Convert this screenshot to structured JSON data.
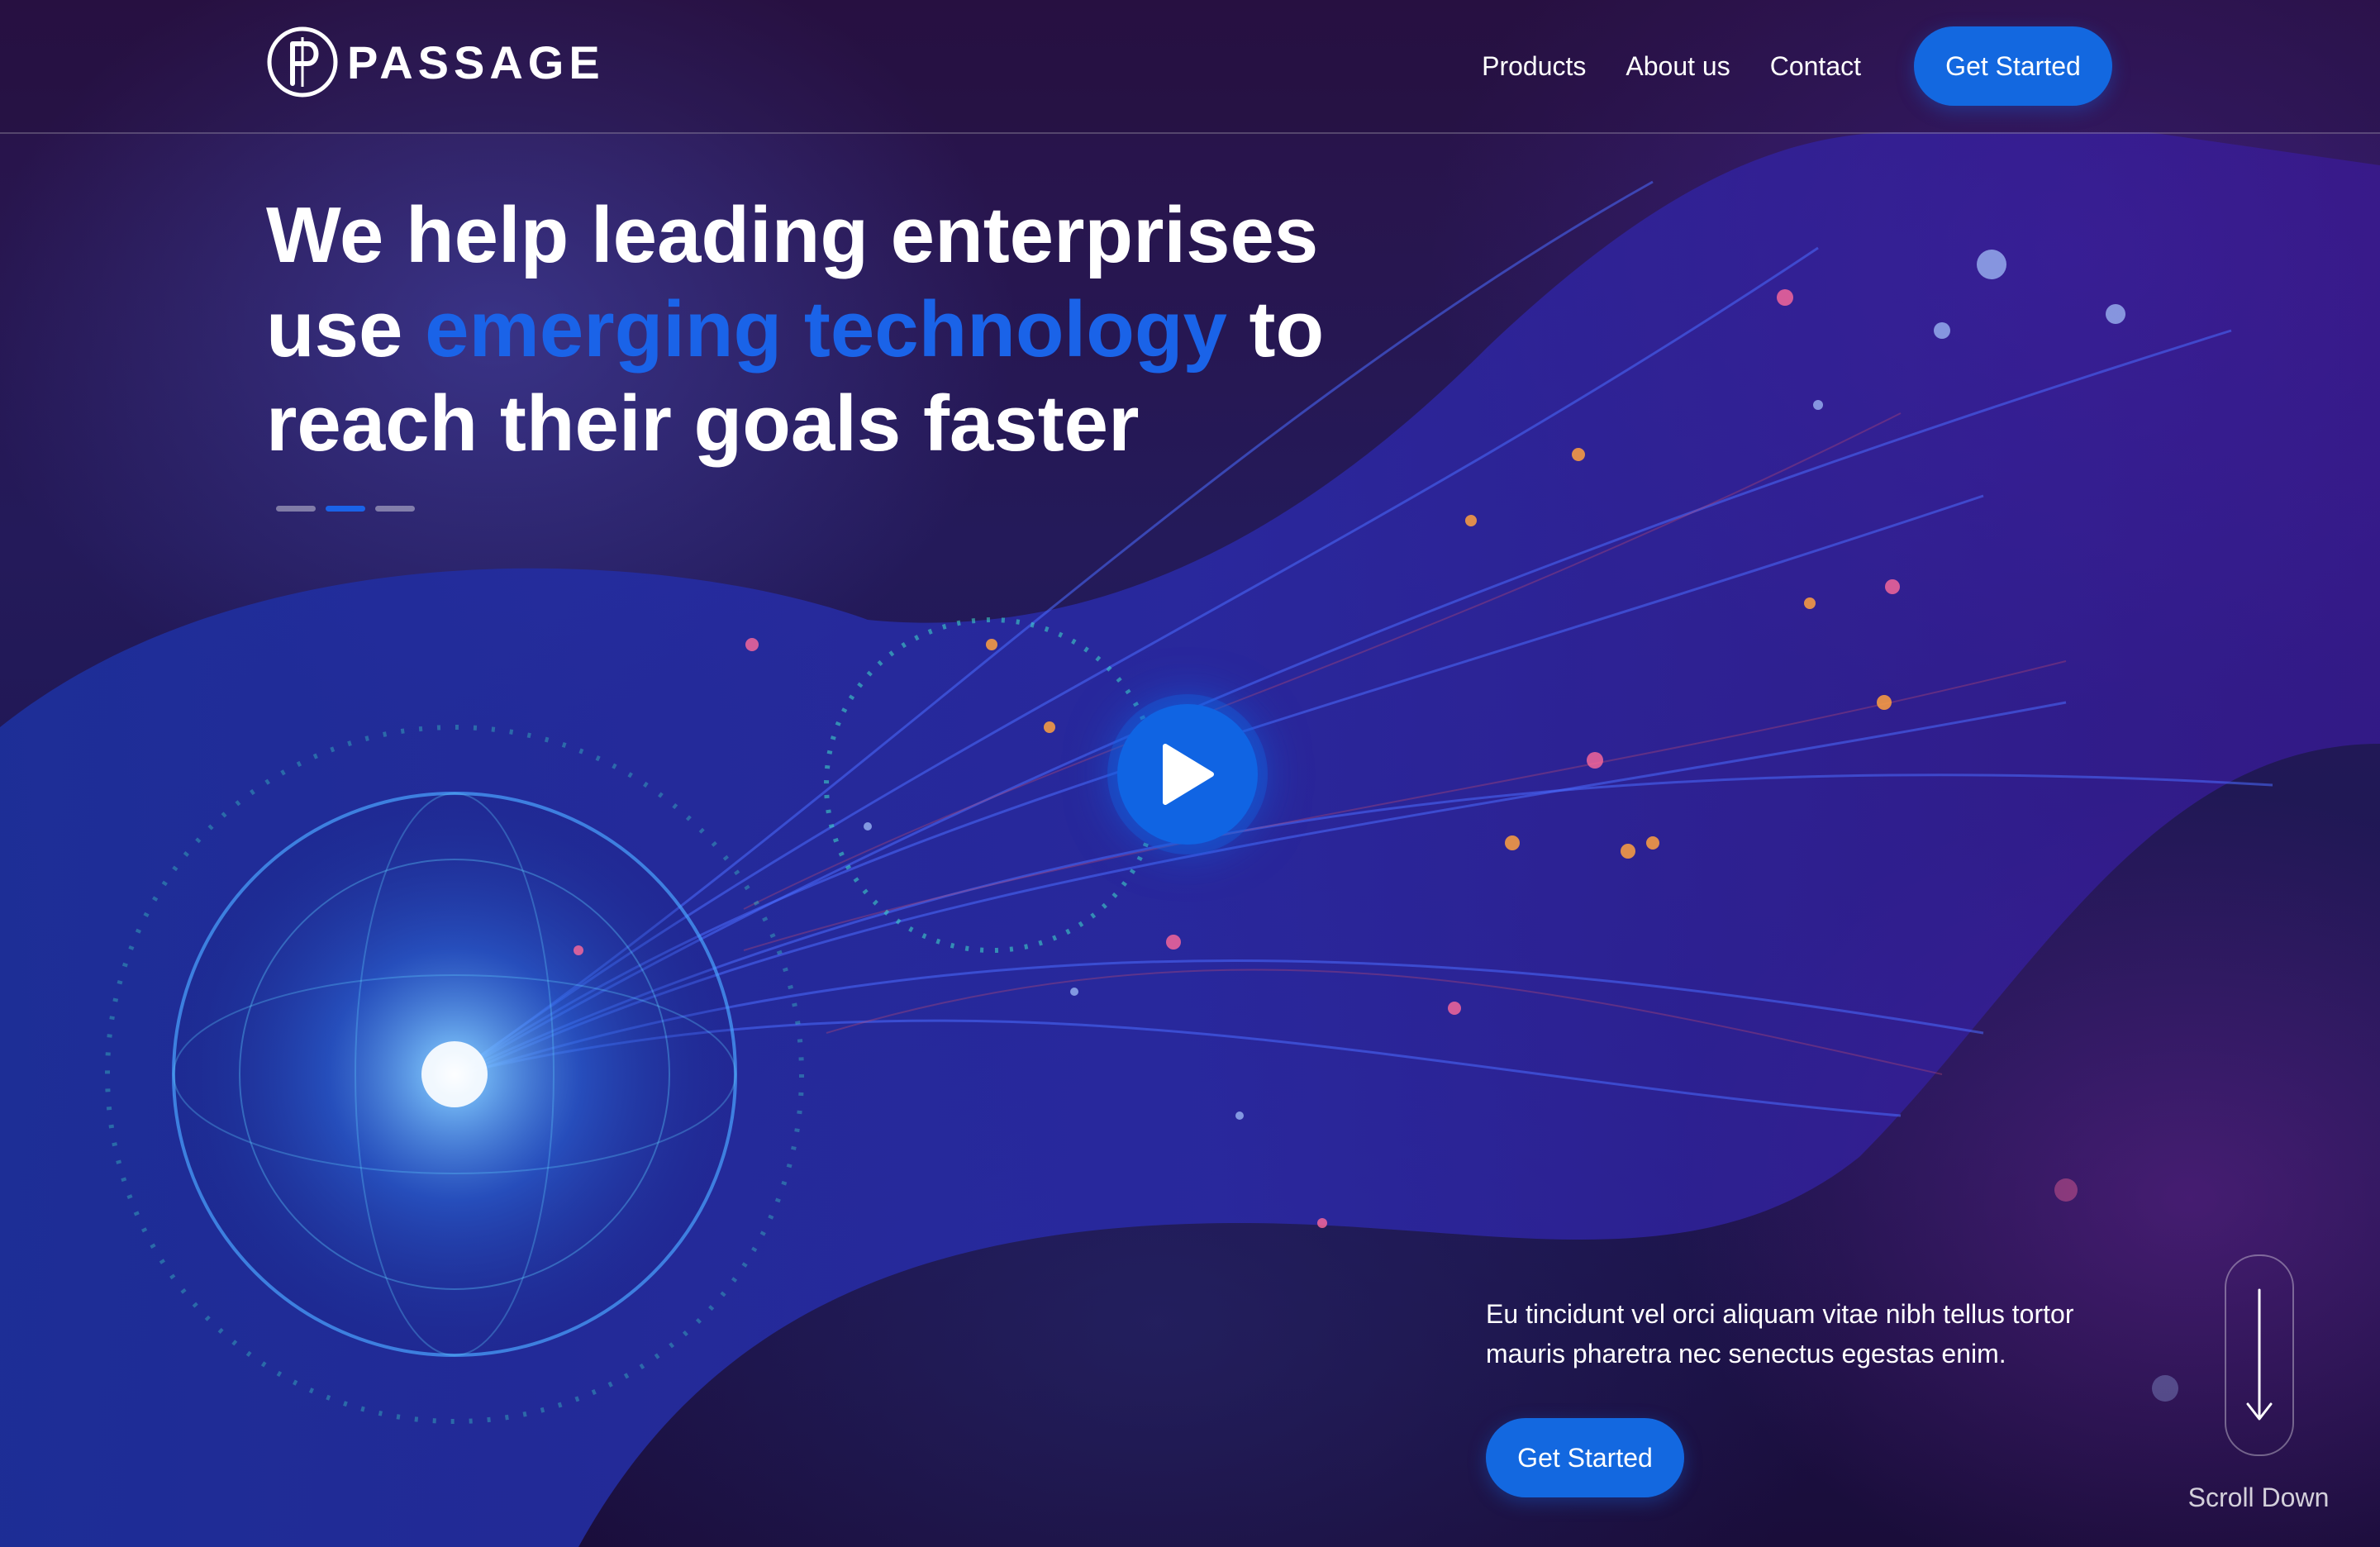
{
  "brand": {
    "name": "PASSAGE",
    "logo_icon": "passage-logo-icon"
  },
  "nav": {
    "items": [
      {
        "label": "Products"
      },
      {
        "label": "About us"
      },
      {
        "label": "Contact"
      }
    ],
    "cta_label": "Get Started"
  },
  "hero": {
    "headline_part1": "We help leading enterprises",
    "headline_part2_prefix": "use ",
    "headline_highlight": "emerging technology",
    "headline_part2_suffix": " to",
    "headline_part3": "reach their goals faster",
    "slider": {
      "count": 3,
      "active_index": 1
    },
    "play_icon": "play-icon"
  },
  "footer_block": {
    "blurb_line1": "Eu tincidunt vel orci aliquam vitae nibh tellus tortor",
    "blurb_line2": "mauris pharetra nec senectus egestas enim.",
    "cta_label": "Get Started",
    "scroll_label": "Scroll Down",
    "scroll_icon": "arrow-down-icon"
  },
  "colors": {
    "accent": "#1368e0",
    "highlight_text": "#1a63e8",
    "background": "#1a0f3d"
  }
}
